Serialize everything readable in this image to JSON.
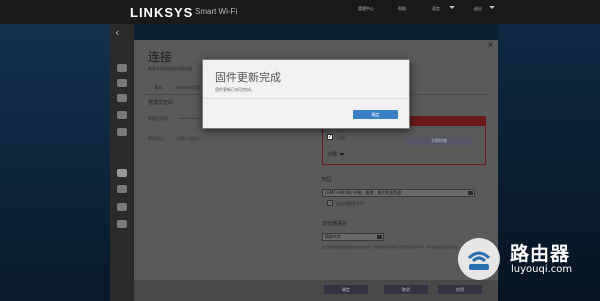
{
  "header": {
    "brand": "LINKSYS",
    "product": "Smart Wi-Fi",
    "nav": [
      "管理中心",
      "帮助",
      "语言",
      "退出"
    ]
  },
  "sidebar": {
    "back": "‹",
    "icons": [
      "dashboard-icon",
      "devices-icon",
      "alert-icon",
      "parental-icon",
      "speed-icon",
      "settings-icon",
      "storage-icon",
      "wireless-icon",
      "security-icon"
    ]
  },
  "panel": {
    "title": "连接",
    "close": "×",
    "subtitle": "查看并管理连接的路由器",
    "tabs": [
      "基本",
      "Internet设置"
    ],
    "router_password_label": "管理员密码",
    "password_label": "管理员密码",
    "password_value": "••••••••",
    "hint_label": "密码提示",
    "hint_value": "无提示(或空)",
    "checkbox_label": "自动",
    "check_button": "立即检查",
    "details": "详细",
    "timezone_label": "时区",
    "timezone_value": "(GMT+08:00) 中国、香港、澳大利亚西部",
    "dst_label": "自动调整夏令时",
    "language_label": "浏览器语言",
    "language_value": "简体中文",
    "language_note": "此设置将改变路由器的默认显示语言。如果您选择的语言与浏览器的语言不同，则以路由器的设置为准。",
    "footer_buttons": [
      "确定",
      "取消",
      "应用"
    ]
  },
  "modal": {
    "title": "固件更新完成",
    "message": "固件更新已成功完成。",
    "ok": "确定"
  },
  "watermark": {
    "text": "路由器",
    "url": "luyouqi.com"
  }
}
